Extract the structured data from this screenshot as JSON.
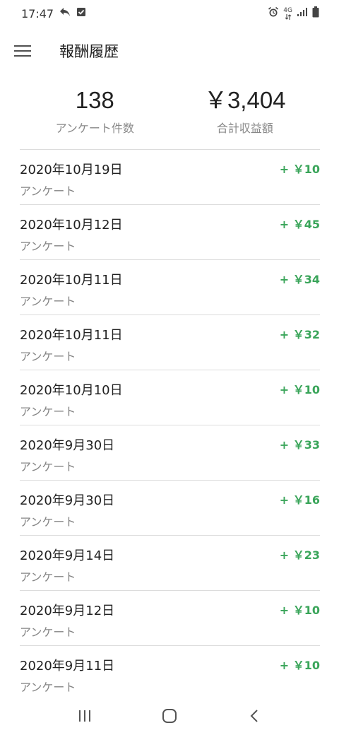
{
  "status_bar": {
    "time": "17:47",
    "network": "4G",
    "icons": [
      "reply-icon",
      "checkbox-icon",
      "alarm-icon",
      "signal-icon",
      "battery-icon"
    ]
  },
  "header": {
    "title": "報酬履歴",
    "menu_icon": "hamburger-menu-icon"
  },
  "summary": {
    "survey_count": "138",
    "survey_count_label": "アンケート件数",
    "total_earnings": "￥3,404",
    "total_earnings_label": "合計収益額"
  },
  "colors": {
    "amount": "#3aa55a",
    "divider": "#dcdcdc",
    "secondary_text": "#858585"
  },
  "history": [
    {
      "date": "2020年10月19日",
      "type": "アンケート",
      "amount": "+ ￥10"
    },
    {
      "date": "2020年10月12日",
      "type": "アンケート",
      "amount": "+ ￥45"
    },
    {
      "date": "2020年10月11日",
      "type": "アンケート",
      "amount": "+ ￥34"
    },
    {
      "date": "2020年10月11日",
      "type": "アンケート",
      "amount": "+ ￥32"
    },
    {
      "date": "2020年10月10日",
      "type": "アンケート",
      "amount": "+ ￥10"
    },
    {
      "date": "2020年9月30日",
      "type": "アンケート",
      "amount": "+ ￥33"
    },
    {
      "date": "2020年9月30日",
      "type": "アンケート",
      "amount": "+ ￥16"
    },
    {
      "date": "2020年9月14日",
      "type": "アンケート",
      "amount": "+ ￥23"
    },
    {
      "date": "2020年9月12日",
      "type": "アンケート",
      "amount": "+ ￥10"
    },
    {
      "date": "2020年9月11日",
      "type": "アンケート",
      "amount": "+ ￥10"
    }
  ],
  "nav_bar": {
    "buttons": [
      "recent-apps-icon",
      "home-icon",
      "back-icon"
    ]
  }
}
